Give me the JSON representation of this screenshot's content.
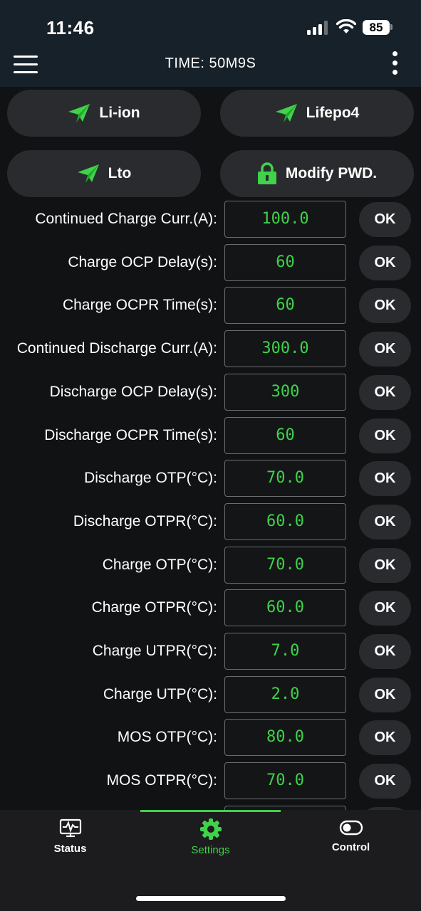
{
  "status_bar": {
    "time": "11:46",
    "battery": "85"
  },
  "header": {
    "title": "TIME: 50M9S"
  },
  "presets": [
    {
      "label": "Li-ion",
      "icon": "paper-plane-icon"
    },
    {
      "label": "Lifepo4",
      "icon": "paper-plane-icon"
    },
    {
      "label": "Lto",
      "icon": "paper-plane-icon"
    },
    {
      "label": "Modify PWD.",
      "icon": "lock-icon"
    }
  ],
  "ok_label": "OK",
  "settings": [
    {
      "label": "Continued Charge Curr.(A):",
      "value": "100.0"
    },
    {
      "label": "Charge OCP Delay(s):",
      "value": "60"
    },
    {
      "label": "Charge OCPR Time(s):",
      "value": "60"
    },
    {
      "label": "Continued Discharge Curr.(A):",
      "value": "300.0"
    },
    {
      "label": "Discharge OCP Delay(s):",
      "value": "300"
    },
    {
      "label": "Discharge OCPR Time(s):",
      "value": "60"
    },
    {
      "label": "Discharge OTP(°C):",
      "value": "70.0"
    },
    {
      "label": "Discharge OTPR(°C):",
      "value": "60.0"
    },
    {
      "label": "Charge OTP(°C):",
      "value": "70.0"
    },
    {
      "label": "Charge OTPR(°C):",
      "value": "60.0"
    },
    {
      "label": "Charge UTPR(°C):",
      "value": "7.0"
    },
    {
      "label": "Charge UTP(°C):",
      "value": "2.0"
    },
    {
      "label": "MOS OTP(°C):",
      "value": "80.0"
    },
    {
      "label": "MOS OTPR(°C):",
      "value": "70.0"
    }
  ],
  "tabs": [
    {
      "label": "Status",
      "icon": "monitor-icon",
      "active": false
    },
    {
      "label": "Settings",
      "icon": "gear-icon",
      "active": true
    },
    {
      "label": "Control",
      "icon": "toggle-icon",
      "active": false
    }
  ],
  "colors": {
    "accent": "#3fd24a",
    "background": "#111214",
    "header": "#172129",
    "button": "#2a2b2e"
  }
}
